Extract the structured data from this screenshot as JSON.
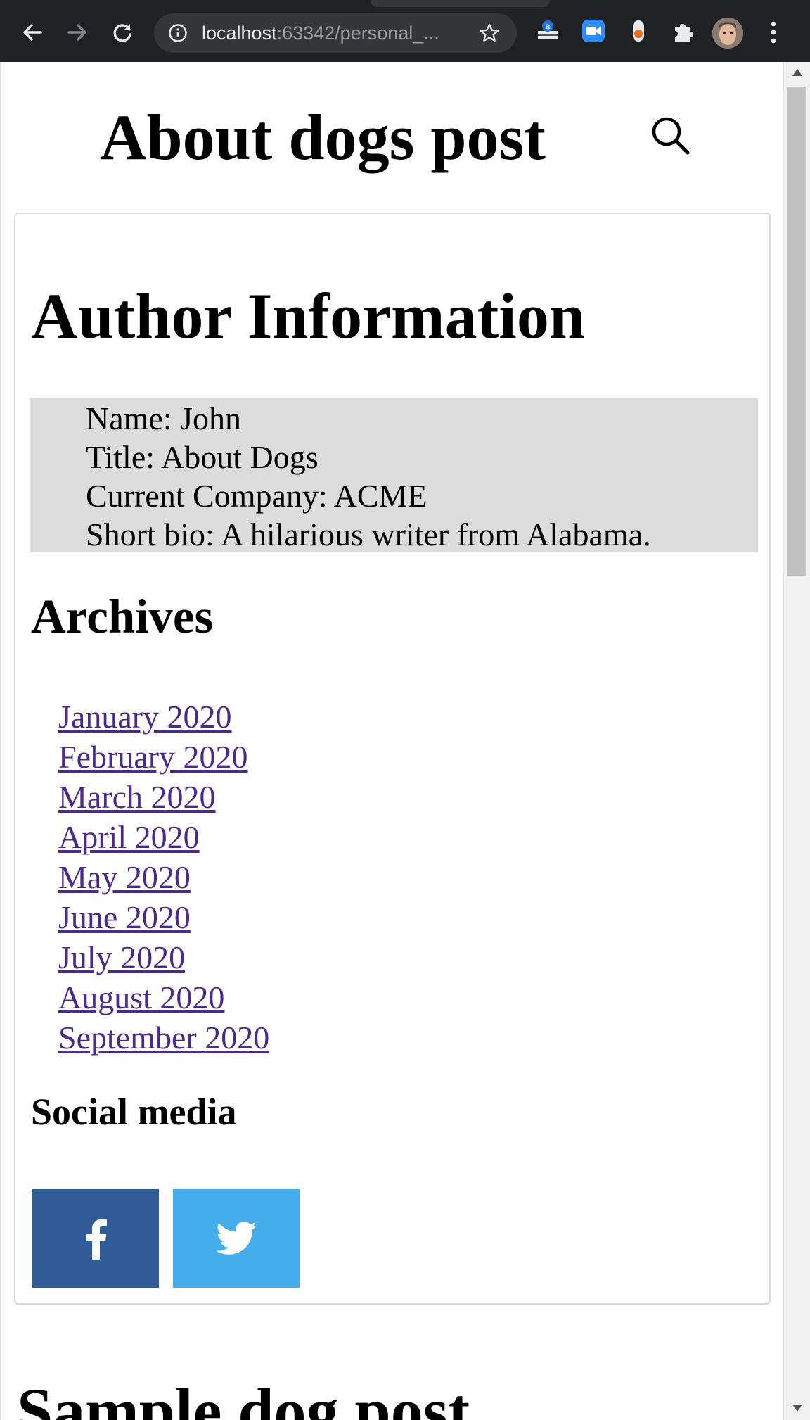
{
  "browser": {
    "url_host": "localhost",
    "url_rest": ":63342/personal_...",
    "toolbar_icons": [
      "back-arrow-icon",
      "forward-arrow-icon",
      "reload-icon",
      "info-icon",
      "star-icon",
      "amazon-extension-icon",
      "zoom-extension-icon",
      "recorder-extension-icon",
      "puzzle-extensions-icon",
      "profile-avatar",
      "kebab-menu-icon"
    ]
  },
  "colors": {
    "chrome_bg": "#202124",
    "omnibox_bg": "#35363a",
    "info_box_bg": "#dcdcdc",
    "link": "#4b2a8a",
    "facebook": "#315b96",
    "twitter": "#45adec"
  },
  "page": {
    "site_title": "About dogs post",
    "author_heading": "Author Information",
    "author_info": [
      "Name: John",
      "Title: About Dogs",
      "Current Company: ACME",
      "Short bio: A hilarious writer from Alabama."
    ],
    "archives_heading": "Archives",
    "archives": [
      "January 2020",
      "February 2020",
      "March 2020",
      "April 2020",
      "May 2020",
      "June 2020",
      "July 2020",
      "August 2020",
      "September 2020"
    ],
    "social_heading": "Social media",
    "social_buttons": [
      "facebook-icon",
      "twitter-icon"
    ],
    "next_post_heading": "Sample dog post"
  }
}
